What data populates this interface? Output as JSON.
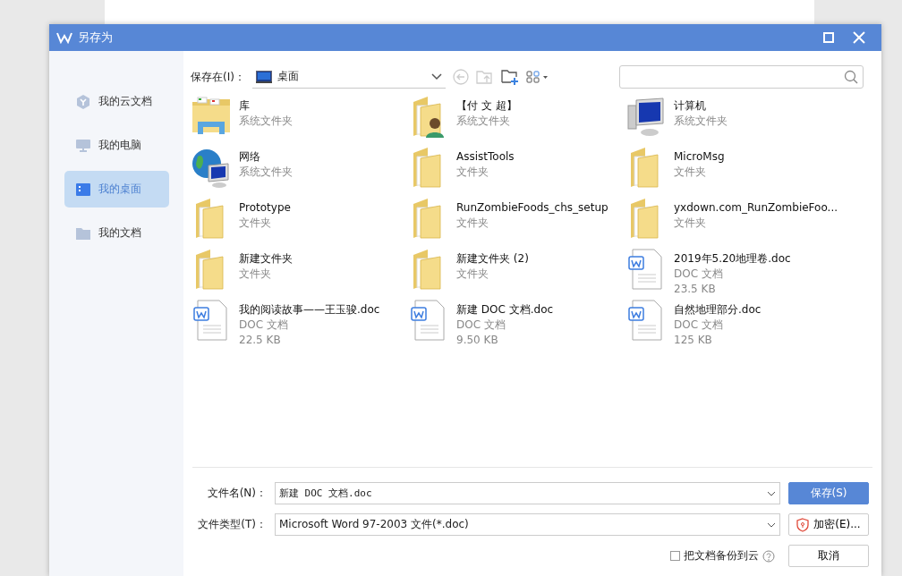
{
  "window": {
    "title": "另存为"
  },
  "sidebar": {
    "items": [
      {
        "label": "我的云文档",
        "kind": "cloud",
        "selected": false
      },
      {
        "label": "我的电脑",
        "kind": "computer",
        "selected": false
      },
      {
        "label": "我的桌面",
        "kind": "desktop",
        "selected": true
      },
      {
        "label": "我的文档",
        "kind": "folder",
        "selected": false
      }
    ]
  },
  "location": {
    "label": "保存在(I)：",
    "value": "桌面"
  },
  "files": [
    {
      "kind": "library",
      "name": "库",
      "type": "系统文件夹"
    },
    {
      "kind": "user",
      "name": "【付 文 超】",
      "type": "系统文件夹"
    },
    {
      "kind": "computer",
      "name": "计算机",
      "type": "系统文件夹"
    },
    {
      "kind": "network",
      "name": "网络",
      "type": "系统文件夹"
    },
    {
      "kind": "folder",
      "name": "AssistTools",
      "type": "文件夹"
    },
    {
      "kind": "folder",
      "name": "MicroMsg",
      "type": "文件夹"
    },
    {
      "kind": "folder",
      "name": "Prototype",
      "type": "文件夹"
    },
    {
      "kind": "folder",
      "name": "RunZombieFoods_chs_setup",
      "type": "文件夹"
    },
    {
      "kind": "folder",
      "name": "yxdown.com_RunZombieFoo...",
      "type": "文件夹"
    },
    {
      "kind": "folder",
      "name": "新建文件夹",
      "type": "文件夹"
    },
    {
      "kind": "folder",
      "name": "新建文件夹 (2)",
      "type": "文件夹"
    },
    {
      "kind": "doc",
      "name": "2019年5.20地理卷.doc",
      "type": "DOC 文档",
      "size": "23.5 KB"
    },
    {
      "kind": "doc",
      "name": "我的阅读故事——王玉骏.doc",
      "type": "DOC 文档",
      "size": "22.5 KB"
    },
    {
      "kind": "doc",
      "name": "新建 DOC 文档.doc",
      "type": "DOC 文档",
      "size": "9.50 KB"
    },
    {
      "kind": "doc",
      "name": "自然地理部分.doc",
      "type": "DOC 文档",
      "size": "125 KB"
    }
  ],
  "form": {
    "filename_label": "文件名(N)：",
    "filename": "新建 DOC 文档.doc",
    "filetype_label": "文件类型(T)：",
    "filetype": "Microsoft Word 97-2003 文件(*.doc)",
    "backup_label": "把文档备份到云",
    "backup_checked": false
  },
  "buttons": {
    "save": "保存(S)",
    "encrypt": "加密(E)...",
    "cancel": "取消"
  }
}
